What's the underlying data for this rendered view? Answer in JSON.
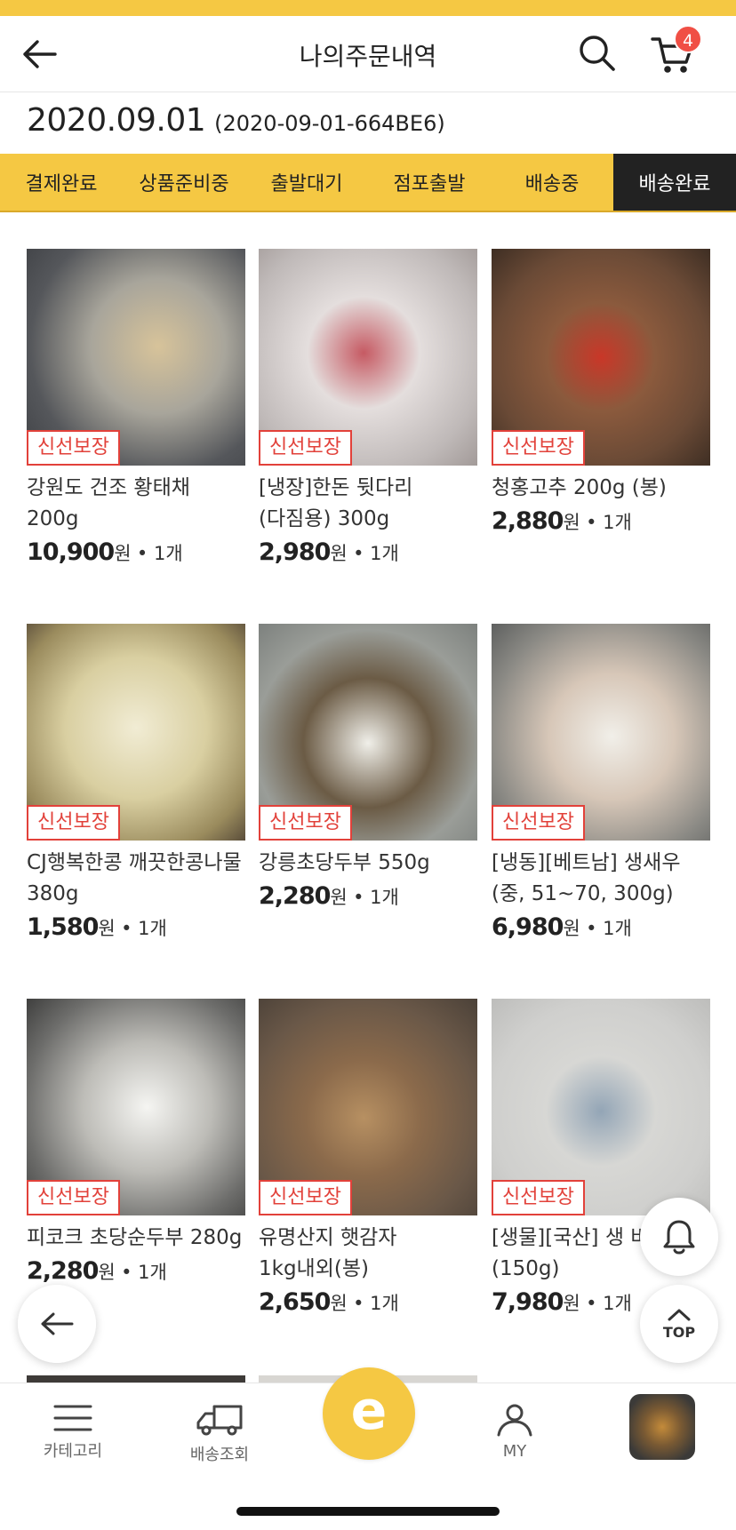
{
  "header": {
    "title": "나의주문내역",
    "cart_count": "4"
  },
  "order": {
    "date": "2020.09.01",
    "number": "(2020-09-01-664BE6)"
  },
  "tabs": [
    {
      "label": "결제완료",
      "active": false
    },
    {
      "label": "상품준비중",
      "active": false
    },
    {
      "label": "출발대기",
      "active": false
    },
    {
      "label": "점포출발",
      "active": false
    },
    {
      "label": "배송중",
      "active": false
    },
    {
      "label": "배송완료",
      "active": true
    }
  ],
  "products": [
    {
      "badge": "신선보장",
      "name": "강원도 건조 황태채 200g",
      "price": "10,900",
      "unit": "원",
      "qty": "• 1개"
    },
    {
      "badge": "신선보장",
      "name": "[냉장]한돈 뒷다리 (다짐용) 300g",
      "price": "2,980",
      "unit": "원",
      "qty": "• 1개"
    },
    {
      "badge": "신선보장",
      "name": "청홍고추 200g (봉)",
      "price": "2,880",
      "unit": "원",
      "qty": "• 1개"
    },
    {
      "badge": "신선보장",
      "name": "CJ행복한콩 깨끗한콩나물 380g",
      "price": "1,580",
      "unit": "원",
      "qty": "• 1개"
    },
    {
      "badge": "신선보장",
      "name": "강릉초당두부 550g",
      "price": "2,280",
      "unit": "원",
      "qty": "• 1개"
    },
    {
      "badge": "신선보장",
      "name": "[냉동][베트남] 생새우 (중, 51~70, 300g)",
      "price": "6,980",
      "unit": "원",
      "qty": "• 1개"
    },
    {
      "badge": "신선보장",
      "name": "피코크 초당순두부 280g",
      "price": "2,280",
      "unit": "원",
      "qty": "• 1개"
    },
    {
      "badge": "신선보장",
      "name": "유명산지 햇감자 1kg내외(봉)",
      "price": "2,650",
      "unit": "원",
      "qty": "• 1개"
    },
    {
      "badge": "신선보장",
      "name": "[생물][국산] 생 바지락살 (150g)",
      "price": "7,980",
      "unit": "원",
      "qty": "• 1개"
    }
  ],
  "floating": {
    "top_label": "TOP"
  },
  "bottom_nav": {
    "category": "카테고리",
    "delivery": "배송조회",
    "center": "e",
    "my": "MY"
  },
  "colors": {
    "brand_yellow": "#f5c843",
    "badge_red": "#e2413a",
    "active_tab": "#222222"
  },
  "icons": [
    "back-arrow-icon",
    "search-icon",
    "cart-icon",
    "bell-icon",
    "chevron-up-icon",
    "menu-icon",
    "truck-icon",
    "person-icon"
  ]
}
